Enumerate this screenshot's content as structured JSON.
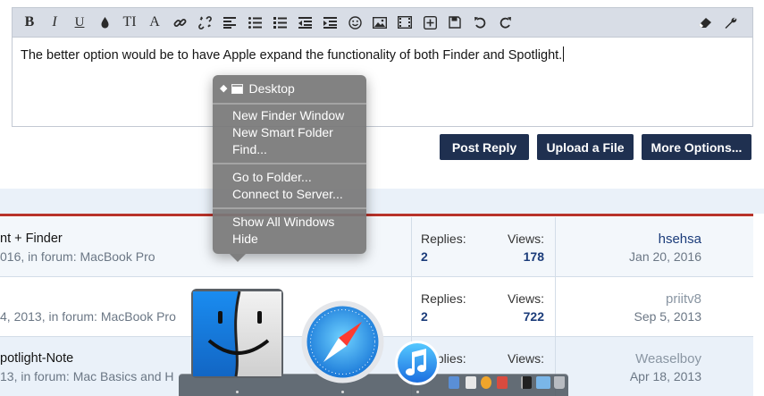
{
  "editor": {
    "toolbar": {
      "bold": "B",
      "italic": "I",
      "underline": "U",
      "font_size": "TI",
      "font_family": "A"
    },
    "text": "The better option would be to have Apple expand the functionality of both Finder and Spotlight."
  },
  "actions": {
    "post_reply": "Post Reply",
    "upload_file": "Upload a File",
    "more_options": "More Options..."
  },
  "context_menu": {
    "header": "Desktop",
    "items": [
      "New Finder Window",
      "New Smart Folder",
      "Find...",
      "Go to Folder...",
      "Connect to Server...",
      "Show All Windows",
      "Hide"
    ]
  },
  "threads": {
    "replies_label": "Replies:",
    "views_label": "Views:",
    "rows": [
      {
        "title": "nt + Finder",
        "sub": "016, in forum: MacBook Pro",
        "replies": "2",
        "views": "178",
        "user": "hsehsa",
        "date": "Jan 20, 2016"
      },
      {
        "title": "",
        "sub": "4, 2013, in forum: MacBook Pro",
        "replies": "2",
        "views": "722",
        "user": "priitv8",
        "date": "Sep 5, 2013"
      },
      {
        "title": "potlight-Note",
        "sub": "13, in forum: Mac Basics and H",
        "replies": "",
        "views": "",
        "user": "Weaselboy",
        "date": "Apr 18, 2013"
      }
    ]
  },
  "colors": {
    "button_bg": "#1f3050",
    "accent_red": "#b8332b",
    "link_blue": "#1b3c7a"
  }
}
